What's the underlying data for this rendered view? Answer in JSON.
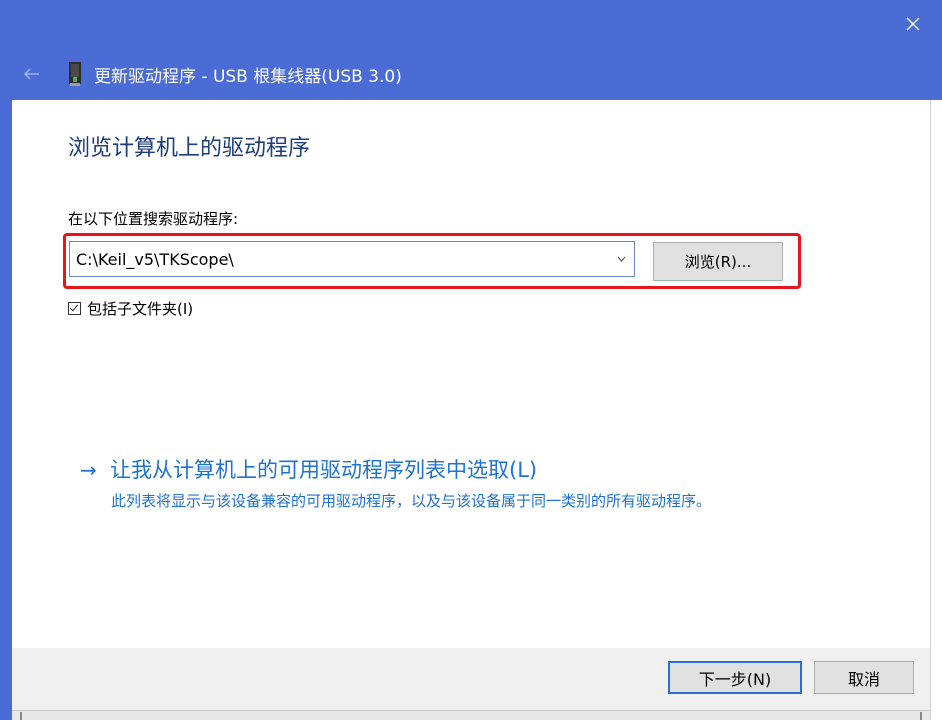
{
  "window": {
    "header_title": "更新驱动程序 - USB 根集线器(USB 3.0)",
    "back_label": "←",
    "close_label": "✕",
    "accent_color": "#4a6cd4"
  },
  "main": {
    "heading": "浏览计算机上的驱动程序",
    "search_label": "在以下位置搜索驱动程序:",
    "path_value": "C:\\Keil_v5\\TKScope\\",
    "browse_label": "浏览(R)...",
    "include_subfolders_label": "包括子文件夹(I)",
    "include_subfolders_checked": true,
    "highlight_color": "#e8141c"
  },
  "pick_option": {
    "arrow": "→",
    "title": "让我从计算机上的可用驱动程序列表中选取(L)",
    "description": "此列表将显示与该设备兼容的可用驱动程序，以及与该设备属于同一类别的所有驱动程序。",
    "link_color": "#1e73d2"
  },
  "footer": {
    "next_label": "下一步(N)",
    "cancel_label": "取消"
  }
}
